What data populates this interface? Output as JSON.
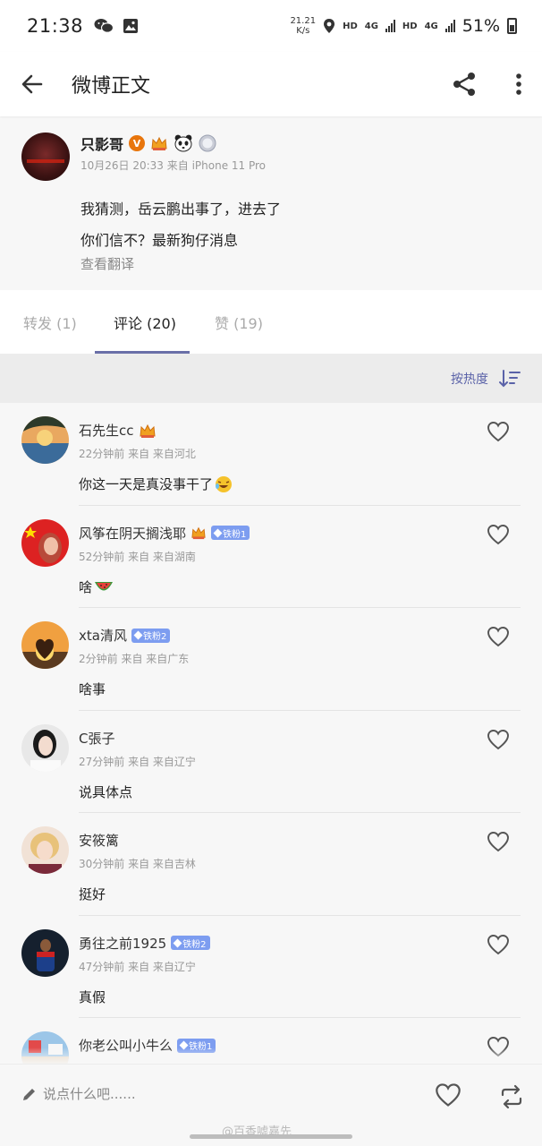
{
  "status_bar": {
    "time": "21:38",
    "speed_value": "21.21",
    "speed_unit": "K/s",
    "hd1": "HD",
    "net1": "4G",
    "hd2": "HD",
    "net2": "4G",
    "battery": "51%"
  },
  "header": {
    "title": "微博正文",
    "icons": [
      "back-arrow-icon",
      "share-icon",
      "more-vertical-icon"
    ]
  },
  "post": {
    "author": "只影哥",
    "verified_label": "V",
    "meta": "10月26日 20:33  来自 iPhone 11 Pro",
    "lines": [
      "我猜测，岳云鹏出事了，进去了",
      "你们信不？最新狗仔消息"
    ],
    "translate": "查看翻译"
  },
  "tabs": [
    {
      "label": "转发 (1)"
    },
    {
      "label": "评论 (20)"
    },
    {
      "label": "赞 (19)"
    }
  ],
  "sort": {
    "label": "按热度"
  },
  "comments": [
    {
      "name": "石先生cc",
      "badge": "",
      "meta": "22分钟前 来自 来自河北",
      "text": "你这一天是真没事干了"
    },
    {
      "name": "风筝在阴天搁浅耶",
      "badge": "铁粉1",
      "meta": "52分钟前 来自 来自湖南",
      "text": "啥"
    },
    {
      "name": "xta清风",
      "badge": "铁粉2",
      "meta": "2分钟前 来自 来自广东",
      "text": "啥事"
    },
    {
      "name": "C張子",
      "badge": "",
      "meta": "27分钟前 来自 来自辽宁",
      "text": "说具体点"
    },
    {
      "name": "安筱篱",
      "badge": "",
      "meta": "30分钟前 来自 来自吉林",
      "text": "挺好"
    },
    {
      "name": "勇往之前1925",
      "badge": "铁粉2",
      "meta": "47分钟前 来自 来自辽宁",
      "text": "真假"
    },
    {
      "name": "你老公叫小牛么",
      "badge": "铁粉1",
      "meta": "",
      "text": ""
    }
  ],
  "bottom_bar": {
    "placeholder": "说点什么吧......",
    "watermark": "@百香嘘嘉先"
  },
  "colors": {
    "accent": "#5a62a8",
    "fan_badge": "#7d9df0",
    "verified": "#e8750c"
  }
}
